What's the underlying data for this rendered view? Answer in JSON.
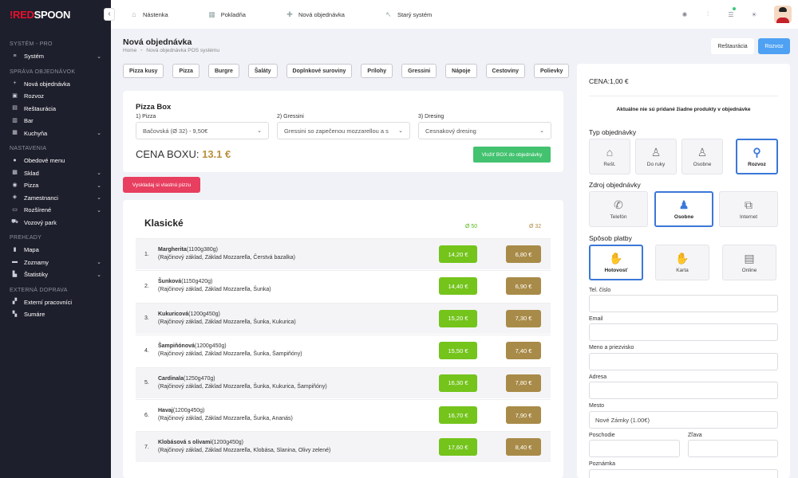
{
  "brand": {
    "logo_mark": "!",
    "logo_red": "RED",
    "logo_white": "SPOON"
  },
  "sidebar": {
    "collapse_icon": "‹",
    "sections": [
      {
        "title": "SYSTÉM - PRO",
        "items": [
          {
            "label": "Systém",
            "icon": "≡",
            "chevron": true
          }
        ]
      },
      {
        "title": "SPRÁVA OBJEDNÁVOK",
        "items": [
          {
            "label": "Nová objednávka",
            "icon": "+",
            "chevron": false
          },
          {
            "label": "Rozvoz",
            "icon": "▣",
            "chevron": false
          },
          {
            "label": "Reštaurácia",
            "icon": "▤",
            "chevron": false
          },
          {
            "label": "Bar",
            "icon": "▥",
            "chevron": false
          },
          {
            "label": "Kuchyňa",
            "icon": "▦",
            "chevron": true
          }
        ]
      },
      {
        "title": "NASTAVENIA",
        "items": [
          {
            "label": "Obedové menu",
            "icon": "●",
            "chevron": false
          },
          {
            "label": "Sklad",
            "icon": "▩",
            "chevron": true
          },
          {
            "label": "Pizza",
            "icon": "◉",
            "chevron": true
          },
          {
            "label": "Zamestnanci",
            "icon": "◈",
            "chevron": true
          },
          {
            "label": "Rozšírené",
            "icon": "▭",
            "chevron": true
          },
          {
            "label": "Vozový park",
            "icon": "⛟",
            "chevron": false
          }
        ]
      },
      {
        "title": "PREHĽADY",
        "items": [
          {
            "label": "Mapa",
            "icon": "▮",
            "chevron": false
          },
          {
            "label": "Zoznamy",
            "icon": "▬",
            "chevron": true
          },
          {
            "label": "Štatistiky",
            "icon": "▙",
            "chevron": true
          }
        ]
      },
      {
        "title": "EXTERNÁ DOPRAVA",
        "items": [
          {
            "label": "Externí pracovníci",
            "icon": "▞",
            "chevron": false
          },
          {
            "label": "Sumáre",
            "icon": "▚",
            "chevron": false
          }
        ]
      }
    ]
  },
  "topnav": [
    {
      "label": "Nástenka",
      "icon": "⌂"
    },
    {
      "label": "Pokladňa",
      "icon": "▦"
    },
    {
      "label": "Nová objednávka",
      "icon": "✚"
    },
    {
      "label": "Starý systém",
      "icon": "↖"
    }
  ],
  "top_icons": [
    "✺",
    "⫶",
    "☰",
    "☀"
  ],
  "page": {
    "title": "Nová objednávka",
    "crumb_home": "Home",
    "crumb_sep": "•",
    "crumb_current": "Nová objednávka POS systému",
    "btn_restaurant": "Reštaurácia",
    "btn_delivery": "Rozvoz"
  },
  "categories": [
    "Pizza kusy",
    "Pizza",
    "Burgre",
    "Šaláty",
    "Doplnkové suroviny",
    "Prílohy",
    "Gressini",
    "Nápoje",
    "Cestoviny",
    "Polievky"
  ],
  "pizzabox": {
    "title": "Pizza Box",
    "label1": "1) Pizza",
    "value1": "Bačovská (Ø 32) - 9,50€",
    "label2": "2) Gressini",
    "value2": "Gressini so zapečenou mozzarellou a s",
    "label3": "3) Dresing",
    "value3": "Cesnakový dresing",
    "price_label": "CENA BOXU:",
    "price_value": "13.1 €",
    "add_button": "Vložiť BOX do objednávky",
    "chevron": "⌄"
  },
  "custom_button": "Vyskladaj si vlastnú pizzu",
  "menu": {
    "section": "Klasické",
    "size1": "Ø 50",
    "size2": "Ø 32",
    "items": [
      {
        "num": "1.",
        "name": "Margherita",
        "weight": "(1100g380g)",
        "desc": "(Rajčinový základ, Základ Mozzarella, Čerstvá bazalka)",
        "p1": "14,20 €",
        "p2": "6,80 €"
      },
      {
        "num": "2.",
        "name": "Šunková",
        "weight": "(1150g420g)",
        "desc": "(Rajčinový základ, Základ Mozzarella, Šunka)",
        "p1": "14,40 €",
        "p2": "6,90 €"
      },
      {
        "num": "3.",
        "name": "Kukuricová",
        "weight": "(1200g450g)",
        "desc": "(Rajčinový základ, Základ Mozzarella, Šunka, Kukurica)",
        "p1": "15,20 €",
        "p2": "7,30 €"
      },
      {
        "num": "4.",
        "name": "Šampiňónová",
        "weight": "(1200g450g)",
        "desc": "(Rajčinový základ, Základ Mozzarella, Šunka, Šampiňóny)",
        "p1": "15,50 €",
        "p2": "7,40 €"
      },
      {
        "num": "5.",
        "name": "Cardinala",
        "weight": "(1250g470g)",
        "desc": "(Rajčinový základ, Základ Mozzarella, Šunka, Kukurica, Šampiňóny)",
        "p1": "16,30 €",
        "p2": "7,80 €"
      },
      {
        "num": "6.",
        "name": "Havaj",
        "weight": "(1200g450g)",
        "desc": "(Rajčinový základ, Základ Mozzarella, Šunka, Ananás)",
        "p1": "16,70 €",
        "p2": "7,90 €"
      },
      {
        "num": "7.",
        "name": "Klobásová s olivami",
        "weight": "(1200g450g)",
        "desc": "(Rajčinový základ, Základ Mozzarella, Klobása, Slanina, Olivy zelené)",
        "p1": "17,60 €",
        "p2": "8,40 €"
      }
    ]
  },
  "order": {
    "total": "CENA:1,00 €",
    "empty": "Aktuálne nie sú pridané žiadne produkty v objednávke",
    "type_title": "Typ objednávky",
    "types": [
      {
        "label": "Rešt.",
        "icon": "⌂"
      },
      {
        "label": "Do ruky",
        "icon": "♙"
      },
      {
        "label": "Osobne",
        "icon": "♙"
      },
      {
        "label": "Rozvoz",
        "icon": "⚲"
      }
    ],
    "source_title": "Zdroj objednávky",
    "sources": [
      {
        "label": "Telefón",
        "icon": "✆"
      },
      {
        "label": "Osobne",
        "icon": "♟"
      },
      {
        "label": "Internet",
        "icon": "⧉"
      }
    ],
    "pay_title": "Spôsob platby",
    "payments": [
      {
        "label": "Hotovosť",
        "icon": "✋"
      },
      {
        "label": "Karta",
        "icon": "✋"
      },
      {
        "label": "Online",
        "icon": "▤"
      }
    ],
    "phone_label": "Tel. číslo",
    "email_label": "Email",
    "name_label": "Meno a priezvisko",
    "address_label": "Adresa",
    "city_label": "Mesto",
    "city_value": "Nové Zámky (1.00€)",
    "zip_label": "Poschodie",
    "discount_label": "Zľava",
    "note_label": "Poznámka"
  }
}
